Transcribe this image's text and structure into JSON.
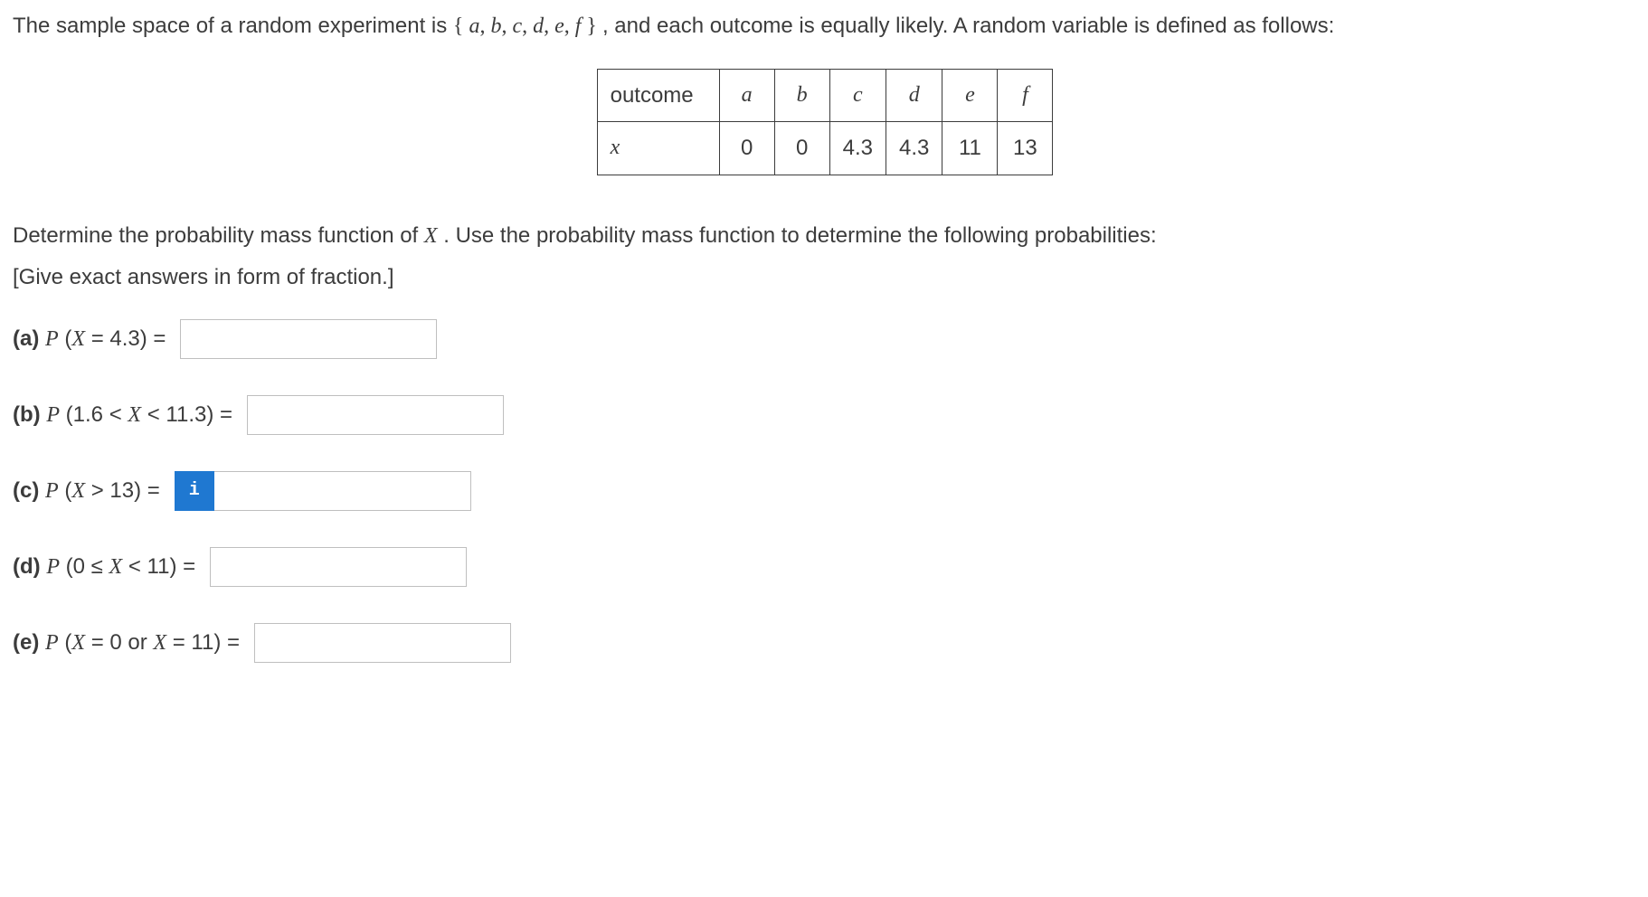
{
  "intro": {
    "text_before_set": "The sample space of a random experiment is ",
    "set": "{a, b, c, d, e, f }",
    "text_after_set": " , and each outcome is equally likely. A random variable is defined as follows:"
  },
  "table": {
    "row_label_outcome": "outcome",
    "row_label_x": "x",
    "headers": [
      "a",
      "b",
      "c",
      "d",
      "e",
      "f"
    ],
    "values": [
      "0",
      "0",
      "4.3",
      "4.3",
      "11",
      "13"
    ]
  },
  "instruction": {
    "line1_before_X": "Determine the probability mass function of ",
    "X": "X",
    "line1_after_X": " . Use the probability mass function to determine the following probabilities:",
    "line2": "[Give exact answers in form of fraction.]"
  },
  "questions": {
    "a": {
      "tag": "(a)",
      "expr_html": "P (X = 4.3) ="
    },
    "b": {
      "tag": "(b)",
      "expr_html": "P (1.6 < X < 11.3) ="
    },
    "c": {
      "tag": "(c)",
      "expr_html": "P (X > 13) ="
    },
    "d": {
      "tag": "(d)",
      "expr_html": "P (0 ≤ X < 11) ="
    },
    "e": {
      "tag": "(e)",
      "expr_html": "P (X = 0 or X = 11) ="
    }
  },
  "icons": {
    "info": "i"
  },
  "answers": {
    "a": "",
    "b": "",
    "c": "",
    "d": "",
    "e": ""
  }
}
